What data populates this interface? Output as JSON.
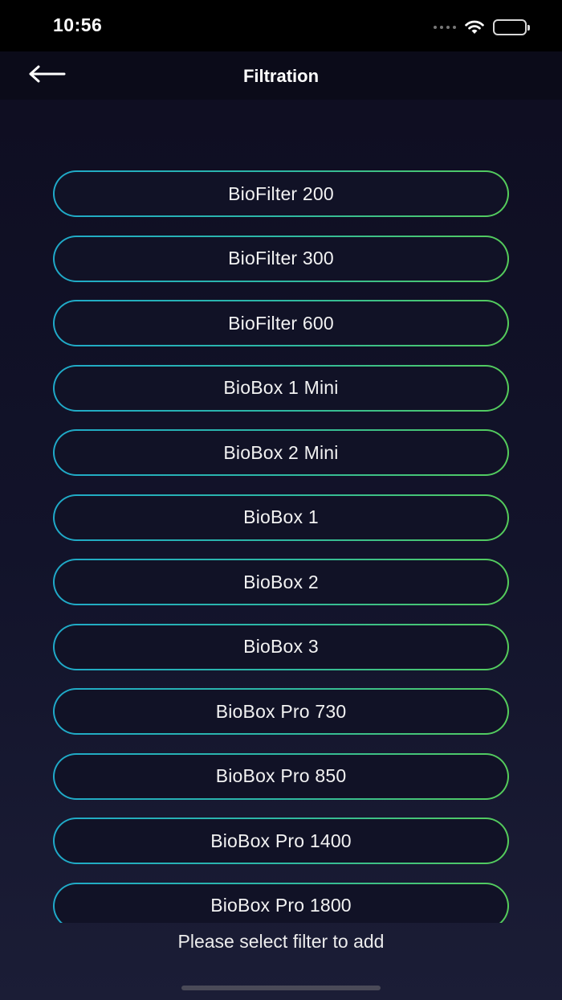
{
  "status_bar": {
    "time": "10:56",
    "icons": [
      "signal-dots-icon",
      "wifi-icon",
      "battery-icon"
    ]
  },
  "nav": {
    "back_icon": "arrow-left-icon",
    "title": "Filtration"
  },
  "filters": [
    {
      "label": "BioFilter 200"
    },
    {
      "label": "BioFilter 300"
    },
    {
      "label": "BioFilter 600"
    },
    {
      "label": "BioBox 1 Mini"
    },
    {
      "label": "BioBox 2 Mini"
    },
    {
      "label": "BioBox 1"
    },
    {
      "label": "BioBox 2"
    },
    {
      "label": "BioBox 3"
    },
    {
      "label": "BioBox Pro 730"
    },
    {
      "label": "BioBox Pro 850"
    },
    {
      "label": "BioBox Pro 1400"
    },
    {
      "label": "BioBox Pro 1800"
    }
  ],
  "hint": "Please select filter to add",
  "colors": {
    "background": "#12132a",
    "border_gradient_start": "#1fa9c9",
    "border_gradient_end": "#55cc5a",
    "text": "#ffffff"
  }
}
